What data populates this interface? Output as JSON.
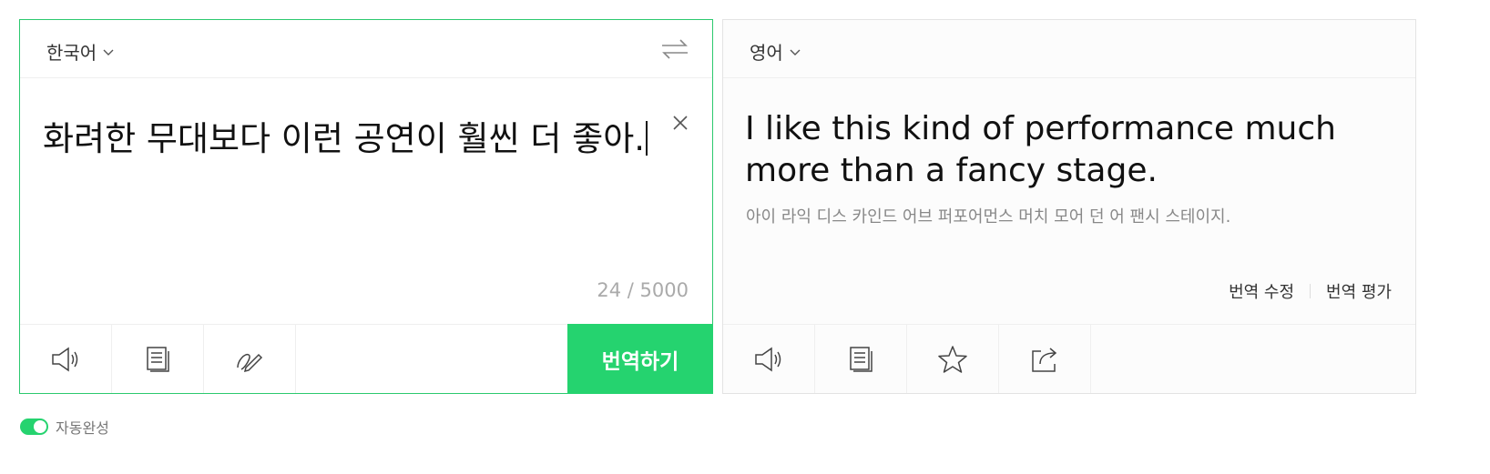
{
  "source": {
    "language": "한국어",
    "text": "화려한 무대보다 이런 공연이 훨씬 더 좋아.",
    "char_count": "24 / 5000"
  },
  "target": {
    "language": "영어",
    "text": "I like this kind of performance much more than a fancy stage.",
    "pronunciation": "아이 라익 디스 카인드 어브 퍼포어먼스 머치 모어 던 어 팬시 스테이지.",
    "edit_label": "번역 수정",
    "rate_label": "번역 평가"
  },
  "translate_button": "번역하기",
  "autocomplete": {
    "label": "자동완성",
    "enabled": true
  },
  "icons": {
    "source_toolbar": [
      "speaker-icon",
      "copy-icon",
      "handwriting-icon"
    ],
    "target_toolbar": [
      "speaker-icon",
      "copy-icon",
      "star-icon",
      "share-icon"
    ],
    "swap": "swap-icon",
    "clear": "close-icon"
  },
  "colors": {
    "accent": "#25d36f",
    "source_border": "#2cc96e"
  }
}
